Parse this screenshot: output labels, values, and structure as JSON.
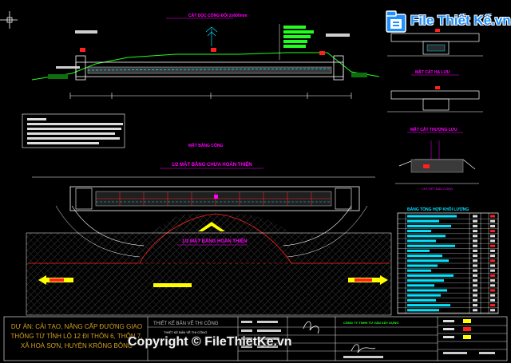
{
  "drawing": {
    "section_title": "CẮT DỌC CỐNG ĐÔI 2x600mm",
    "plan_title_top": "MẶT BẰNG CỐNG",
    "plan_title_1": "1/2 MẶT BẰNG CHƯA HOÀN THIỆN",
    "plan_title_2": "1/2 MẶT BẰNG HOÀN THIỆN",
    "side_label_1": "MẶT CẮT HẠ LƯU",
    "side_label_2": "MẶT CẮT THƯỢNG LƯU",
    "detail_label": "CHI TIẾT ĐẦU CỐNG",
    "table_title": "BẢNG TỔNG HỢP KHỐI LƯỢNG"
  },
  "title_block": {
    "project_text": "DỰ ÁN: CẢI TẠO, NÂNG CẤP ĐƯỜNG GIAO THÔNG TỪ TỈNH LỘ 12 ĐI THÔN 6, THÔN 7, XÃ HOÀ SƠN, HUYỆN KRÔNG BÔNG",
    "stage": "THIẾT KẾ BẢN VẼ THI CÔNG",
    "drawing_name": "THIẾT KẾ BẢN VẼ THI CÔNG",
    "company": "CÔNG TY TNHH TƯ VẤN XÂY DỰNG"
  },
  "watermark": {
    "brand": "File Thiết Kế.vn",
    "copyright": "Copyright © FileThietKe.vn"
  },
  "colors": {
    "background": "#000000",
    "red": "#ff2020",
    "yellow": "#ffff00",
    "green": "#20ff20",
    "cyan": "#00e5ff",
    "magenta": "#ff00ff",
    "white": "#ffffff",
    "brand_blue": "#1e90ff"
  }
}
